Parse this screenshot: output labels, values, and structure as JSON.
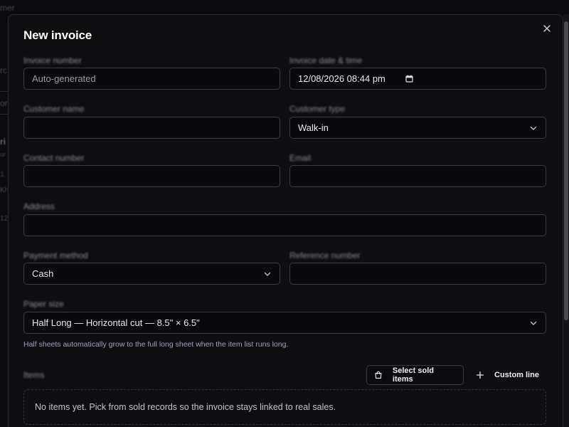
{
  "background": {
    "fragments": [
      "mer",
      "rc",
      "on",
      "ri",
      "ur",
      "1",
      "Kh",
      "12"
    ]
  },
  "modal": {
    "title": "New invoice",
    "close_icon": "close-icon"
  },
  "fields": {
    "invoice_number": {
      "label": "Invoice number",
      "placeholder": "Auto-generated",
      "value": ""
    },
    "invoice_datetime": {
      "label": "Invoice date & time",
      "value": "12/08/2026 08:44 pm",
      "icon": "calendar-icon"
    },
    "customer_name": {
      "label": "Customer name",
      "value": ""
    },
    "customer_type": {
      "label": "Customer type",
      "selected": "Walk-in"
    },
    "contact_number": {
      "label": "Contact number",
      "value": ""
    },
    "email": {
      "label": "Email",
      "value": ""
    },
    "address": {
      "label": "Address",
      "value": ""
    },
    "payment_method": {
      "label": "Payment method",
      "selected": "Cash"
    },
    "reference_number": {
      "label": "Reference number",
      "value": ""
    },
    "paper_size": {
      "label": "Paper size",
      "selected": "Half Long — Horizontal cut — 8.5\" × 6.5\"",
      "help": "Half sheets automatically grow to the full long sheet when the item list runs long."
    }
  },
  "items": {
    "label": "Items",
    "select_sold_label": "Select sold items",
    "custom_line_label": "Custom line",
    "empty_message": "No items yet. Pick from sold records so the invoice stays linked to real sales."
  },
  "colors": {
    "background": "#0b0b0d",
    "modal": "#0e0e10",
    "border": "#3a3a40",
    "help_text": "#9fa0c0"
  }
}
